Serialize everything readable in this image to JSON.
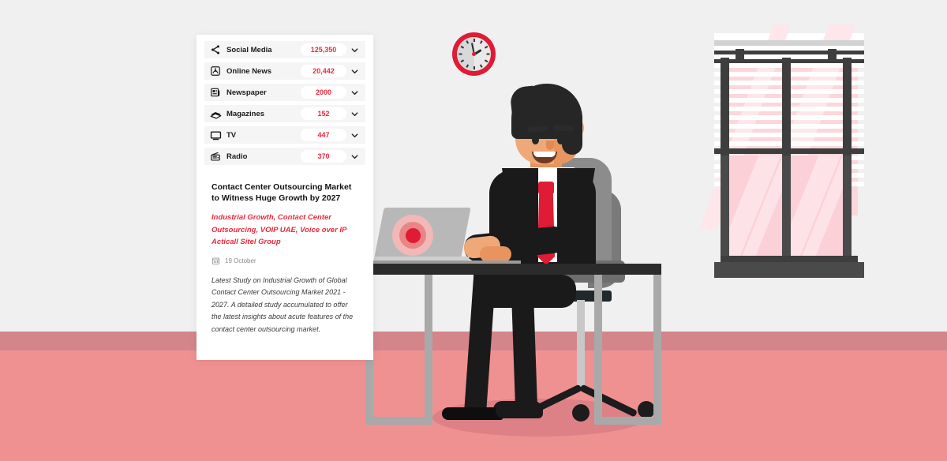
{
  "scene": {
    "wall_color": "#F0F0F0",
    "baseboard_color": "#D4858A",
    "floor_color": "#F09191",
    "accent_red": "#E01B35",
    "value_red": "#F0283C"
  },
  "clock": {
    "name": "wall-clock",
    "time": "1:58"
  },
  "window": {
    "name": "window-with-blinds",
    "glass_color": "#FBD0D7",
    "frame_color": "#4A4A4A"
  },
  "laptop": {
    "name": "laptop",
    "screen_graphic": "radar-pulse"
  },
  "person": {
    "name": "businessman",
    "skin": "#EFA878",
    "suit": "#1A1A1A",
    "tie": "#E01B35"
  },
  "chair": {
    "name": "office-chair",
    "color": "#8C8C8C"
  },
  "desk": {
    "name": "desk",
    "top_color": "#2B2B2B",
    "leg_color": "#A9A9A9"
  },
  "card": {
    "media_list": [
      {
        "icon": "share-icon",
        "label": "Social Media",
        "value": "125,350",
        "chevron": "chevron-down-icon"
      },
      {
        "icon": "rss-feed-icon",
        "label": "Online News",
        "value": "20,442",
        "chevron": "chevron-down-icon"
      },
      {
        "icon": "newspaper-icon",
        "label": "Newspaper",
        "value": "2000",
        "chevron": "chevron-down-icon"
      },
      {
        "icon": "magazines-icon",
        "label": "Magazines",
        "value": "152",
        "chevron": "chevron-down-icon"
      },
      {
        "icon": "tv-icon",
        "label": "TV",
        "value": "447",
        "chevron": "chevron-down-icon"
      },
      {
        "icon": "radio-icon",
        "label": "Radio",
        "value": "370",
        "chevron": "chevron-down-icon"
      }
    ],
    "article": {
      "title": "Contact Center Outsourcing Market to Witness Huge Growth by 2027",
      "tags": "Industrial Growth, Contact Center Outsourcing, VOIP UAE, Voice over IP Acticall Sitel Group",
      "date_icon": "calendar-icon",
      "date": "19 October",
      "description": "Latest Study on Industrial Growth of Global Contact Center Outsourcing Market 2021 - 2027. A detailed study accumulated to offer the latest insights about acute features of the contact center outsourcing market."
    }
  }
}
